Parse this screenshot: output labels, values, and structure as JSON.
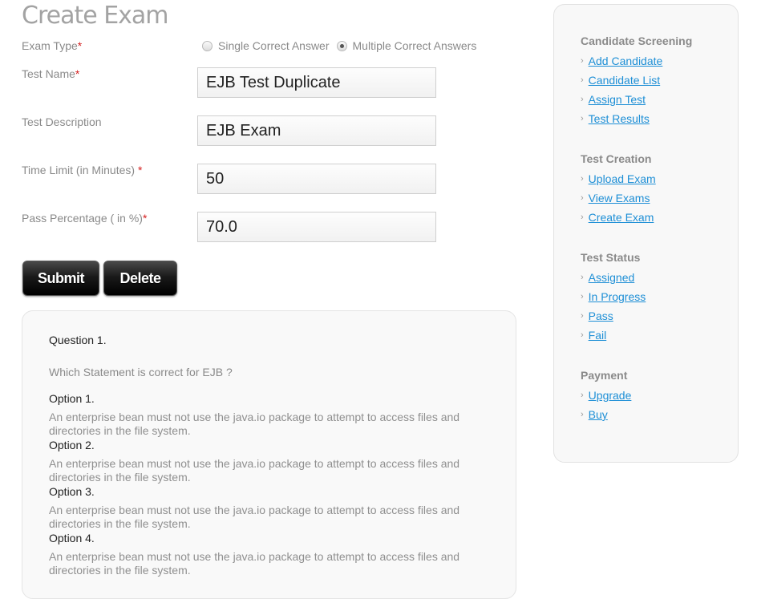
{
  "page": {
    "title": "Create Exam"
  },
  "form": {
    "exam_type": {
      "label": "Exam Type",
      "required": "*",
      "options": [
        "Single Correct Answer",
        "Multiple Correct Answers"
      ],
      "selected": "Multiple Correct Answers"
    },
    "test_name": {
      "label": "Test Name",
      "required": "*",
      "value": "EJB Test Duplicate"
    },
    "test_description": {
      "label": "Test Description",
      "value": "EJB Exam"
    },
    "time_limit": {
      "label": "Time Limit (in Minutes) ",
      "required": "*",
      "value": "50"
    },
    "pass_percentage": {
      "label": "Pass Percentage ( in %)",
      "required": "*",
      "value": "70.0"
    },
    "buttons": {
      "submit": "Submit",
      "delete": "Delete"
    }
  },
  "question": {
    "title": "Question 1.",
    "text": "Which Statement is correct for EJB ?",
    "options": [
      {
        "label": "Option 1.",
        "text": "An enterprise bean must not use the java.io package to attempt to access files and directories in the file system."
      },
      {
        "label": "Option 2.",
        "text": "An enterprise bean must not use the java.io package to attempt to access files and directories in the file system."
      },
      {
        "label": "Option 3.",
        "text": "An enterprise bean must not use the java.io package to attempt to access files and directories in the file system."
      },
      {
        "label": "Option 4.",
        "text": "An enterprise bean must not use the java.io package to attempt to access files and directories in the file system."
      }
    ]
  },
  "sidebar": {
    "sections": [
      {
        "title": "Candidate Screening",
        "links": [
          "Add Candidate",
          "Candidate List",
          "Assign Test",
          "Test Results"
        ]
      },
      {
        "title": "Test Creation",
        "links": [
          "Upload Exam",
          "View Exams",
          "Create Exam"
        ]
      },
      {
        "title": "Test Status",
        "links": [
          "Assigned",
          "In Progress",
          "Pass",
          "Fail"
        ]
      },
      {
        "title": "Payment",
        "links": [
          "Upgrade",
          "Buy"
        ]
      }
    ],
    "bullet": "›"
  },
  "colors": {
    "link": "#1e8fd6",
    "required": "#d41f1f",
    "button": "#000000",
    "title": "#a3a3a3"
  }
}
